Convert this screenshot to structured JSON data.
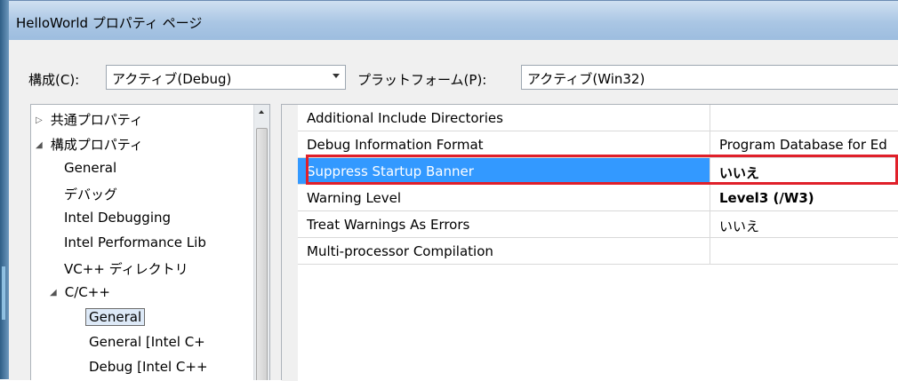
{
  "window": {
    "title": "HelloWorld プロパティ ページ"
  },
  "toolbar": {
    "config_label": "構成(C):",
    "config_value": "アクティブ(Debug)",
    "platform_label": "プラットフォーム(P):",
    "platform_value": "アクティブ(Win32)"
  },
  "tree": {
    "items": [
      {
        "label": "共通プロパティ",
        "expander": "▷"
      },
      {
        "label": "構成プロパティ",
        "expander": "◢"
      },
      {
        "label": "General"
      },
      {
        "label": "デバッグ"
      },
      {
        "label": "Intel Debugging"
      },
      {
        "label": "Intel Performance Lib"
      },
      {
        "label": "VC++ ディレクトリ"
      },
      {
        "label": "C/C++",
        "expander": "◢"
      },
      {
        "label": "General",
        "selected": true
      },
      {
        "label": "General [Intel C+"
      },
      {
        "label": "Debug [Intel C++"
      }
    ]
  },
  "properties": {
    "rows": [
      {
        "name": "Additional Include Directories",
        "value": ""
      },
      {
        "name": "Debug Information Format",
        "value": "Program Database for Ed"
      },
      {
        "name": "Suppress Startup Banner",
        "value": "いいえ",
        "bold": true,
        "selected": true
      },
      {
        "name": "Warning Level",
        "value": "Level3 (/W3)",
        "bold": true
      },
      {
        "name": "Treat Warnings As Errors",
        "value": "いいえ"
      },
      {
        "name": "Multi-processor Compilation",
        "value": ""
      }
    ]
  },
  "colors": {
    "selection": "#3399ff",
    "highlight_border": "#e0202a",
    "title_bar": "#aac6e4"
  }
}
